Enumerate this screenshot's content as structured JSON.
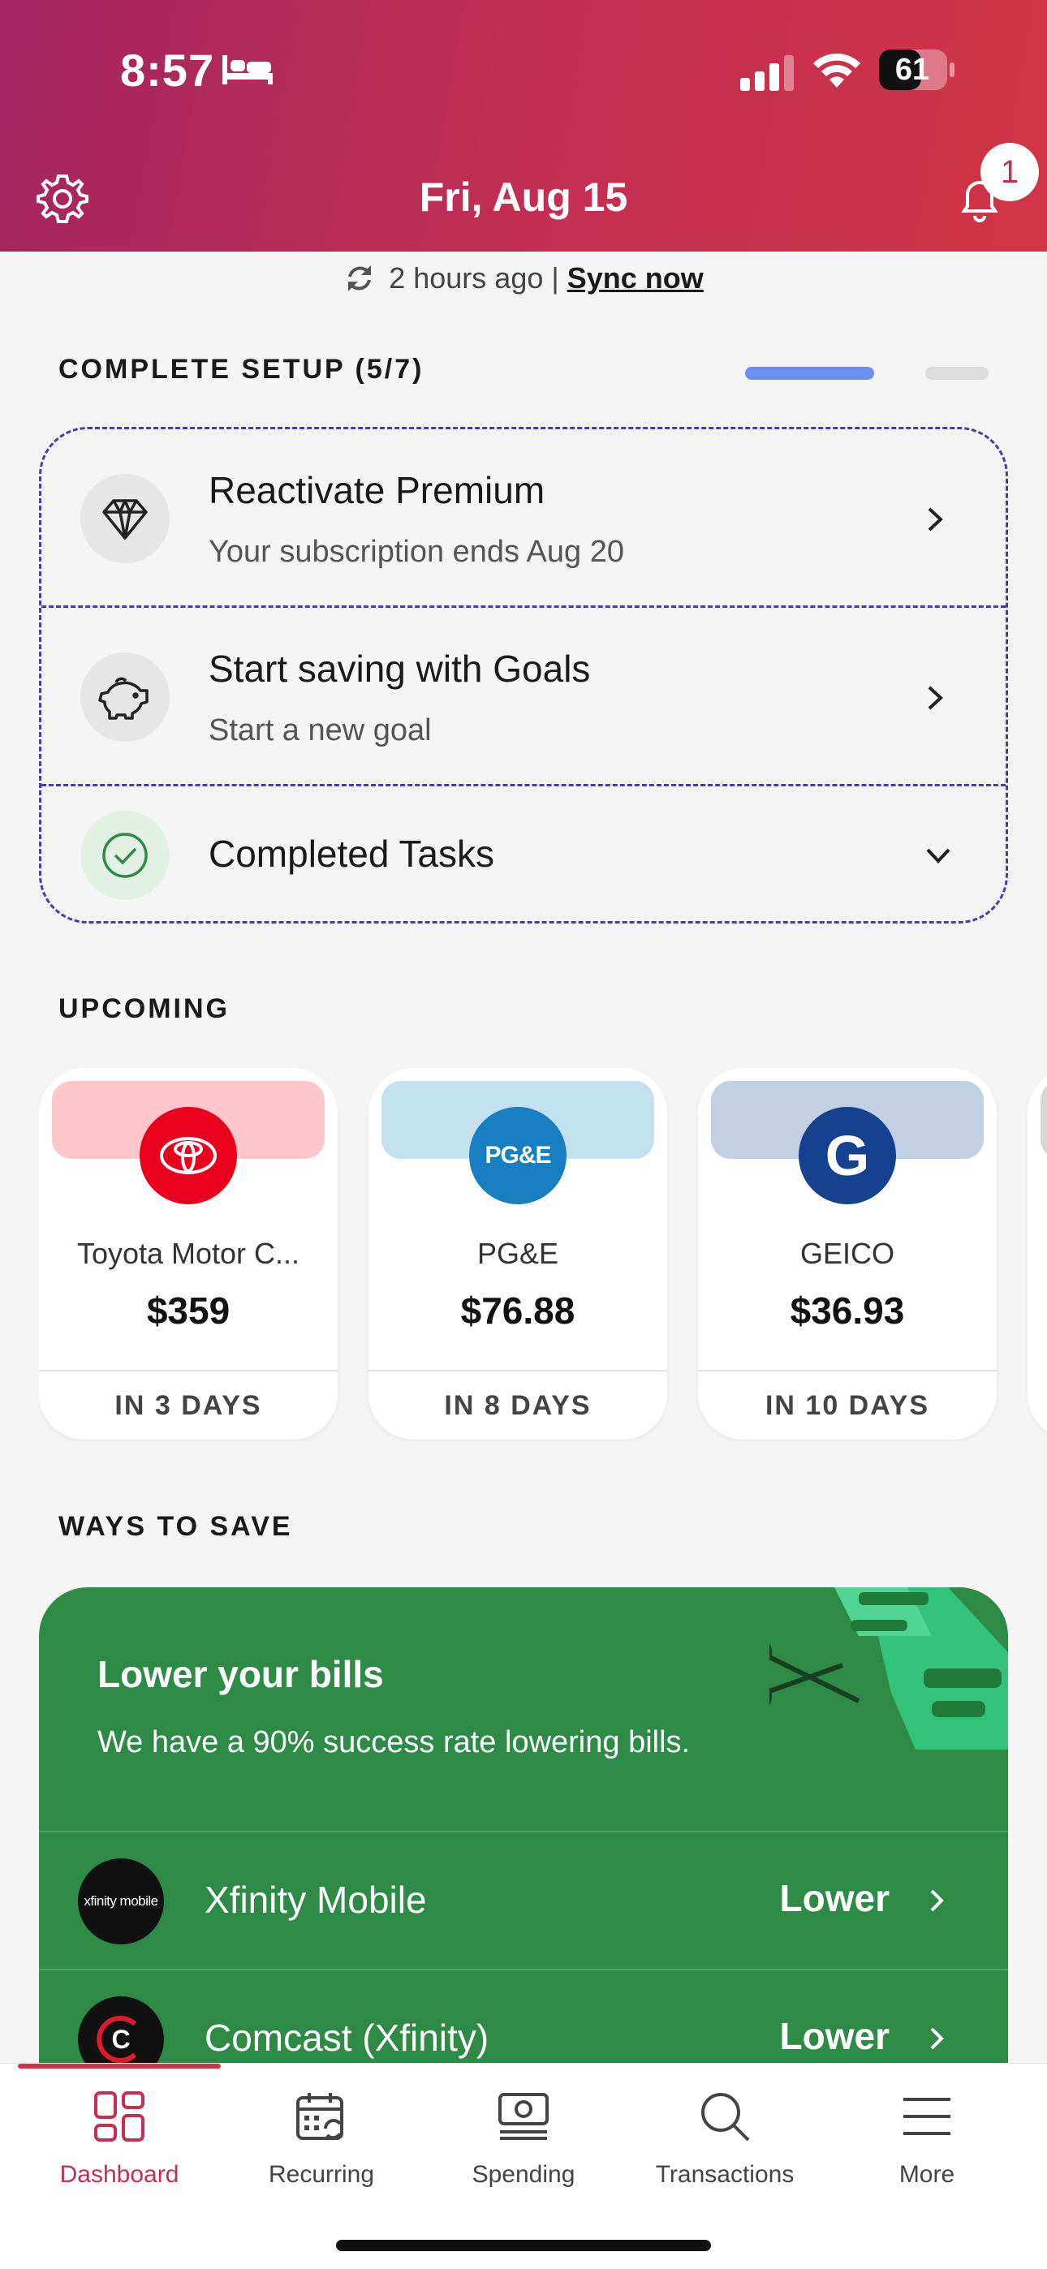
{
  "status_bar": {
    "time": "8:57",
    "battery": "61"
  },
  "header": {
    "date": "Fri, Aug 15",
    "notification_count": "1"
  },
  "sync": {
    "text": "2 hours ago |",
    "link": "Sync now"
  },
  "setup": {
    "title": "COMPLETE SETUP (5/7)",
    "progress": 0.74,
    "items": [
      {
        "title": "Reactivate Premium",
        "subtitle": "Your subscription ends Aug 20",
        "icon": "diamond-icon"
      },
      {
        "title": "Start saving with Goals",
        "subtitle": "Start a new goal",
        "icon": "piggy-bank-icon"
      },
      {
        "title": "Completed Tasks",
        "icon": "check-circle-icon"
      }
    ]
  },
  "upcoming": {
    "title": "UPCOMING",
    "bills": [
      {
        "name": "Toyota Motor C...",
        "amount": "$359",
        "due": "IN 3 DAYS",
        "color": "#e8001c",
        "band": "#ffc6cb"
      },
      {
        "name": "PG&E",
        "amount": "$76.88",
        "due": "IN 8 DAYS",
        "color": "#1a7fc1",
        "band": "#c4e1f0",
        "logo_text": "PG&E"
      },
      {
        "name": "GEICO",
        "amount": "$36.93",
        "due": "IN 10 DAYS",
        "color": "#15418f",
        "band": "#c3cfe3",
        "logo_text": "G"
      }
    ]
  },
  "ways_to_save": {
    "title": "WAYS TO SAVE",
    "card_title": "Lower your bills",
    "card_subtitle": "We have a 90% success rate lowering bills.",
    "providers": [
      {
        "name": "Xfinity Mobile",
        "action": "Lower",
        "logo_text": "xfinity mobile"
      },
      {
        "name": "Comcast (Xfinity)",
        "action": "Lower",
        "logo_text": "C"
      }
    ]
  },
  "tabs": [
    {
      "label": "Dashboard",
      "active": true
    },
    {
      "label": "Recurring"
    },
    {
      "label": "Spending"
    },
    {
      "label": "Transactions"
    },
    {
      "label": "More"
    }
  ],
  "colors": {
    "accent": "#c42f52",
    "save_green": "#2e8b45",
    "progress": "#6b8ff0"
  }
}
